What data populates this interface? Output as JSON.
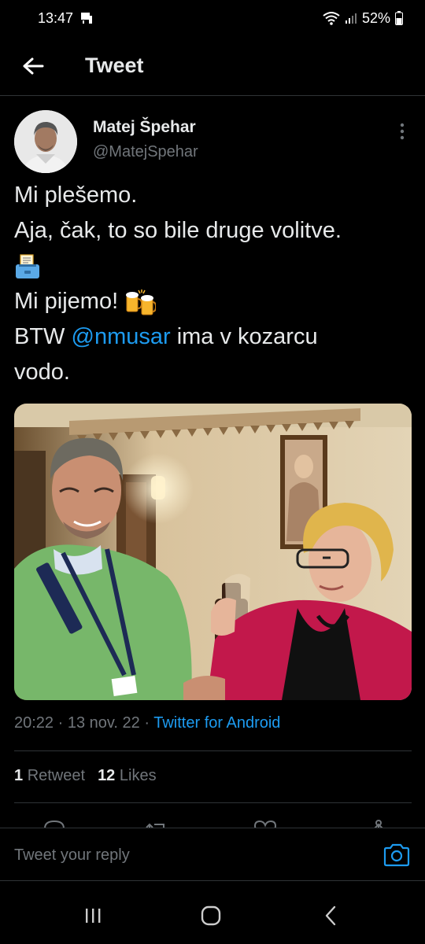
{
  "status_bar": {
    "time": "13:47",
    "battery": "52%",
    "icons": [
      "media-icon",
      "wifi-icon",
      "signal-icon",
      "battery-icon"
    ]
  },
  "header": {
    "title": "Tweet",
    "back_icon": "arrow-left-icon"
  },
  "tweet": {
    "display_name": "Matej Špehar",
    "handle": "@MatejSpehar",
    "text_line1": "Mi plešemo.",
    "text_line2": "Aja, čak, to so bile druge volitve.",
    "text_line3_icon": "ballot-box-emoji",
    "text_line4": "Mi pijemo! ",
    "text_line4_icon": "clinking-beer-mugs-emoji",
    "text_line5_prefix": "BTW ",
    "mention": "@nmusar",
    "text_line5_suffix": " ima v kozarcu",
    "text_line6": "vodo.",
    "time": "20:22",
    "date": "13 nov. 22",
    "dot": "·",
    "source": "Twitter for Android",
    "retweets_count": "1",
    "retweets_label": "Retweet",
    "likes_count": "12",
    "likes_label": "Likes",
    "actions": [
      "reply-icon",
      "retweet-icon",
      "like-icon",
      "share-icon"
    ]
  },
  "reply": {
    "placeholder": "Tweet your reply",
    "camera_icon": "camera-icon"
  },
  "nav": {
    "icons": [
      "recent-apps-icon",
      "home-icon",
      "back-icon"
    ]
  },
  "colors": {
    "background": "#000000",
    "text": "#e7e9ea",
    "secondary": "#71767b",
    "accent": "#1d9bf0",
    "divider": "#2f3336"
  }
}
